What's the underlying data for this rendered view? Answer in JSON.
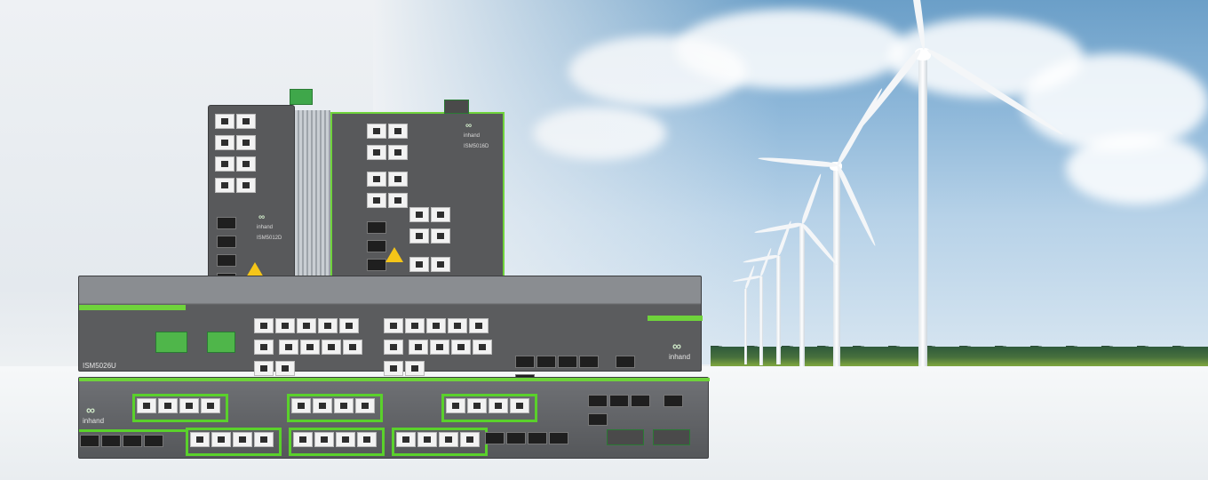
{
  "scene": {
    "description_colors": {
      "sky": "#8db7d9",
      "device_body": "#58595b",
      "accent_green": "#5ad12b",
      "floor": "#f3f5f6"
    }
  },
  "devices": {
    "front_left_model": "ISM5012D",
    "front_right_model": "ISM5016D",
    "rack_model": "ISM5026U",
    "brand": "inhand"
  },
  "icons": [
    "inhand-logo-icon",
    "warning-icon",
    "wind-turbine-icon"
  ]
}
